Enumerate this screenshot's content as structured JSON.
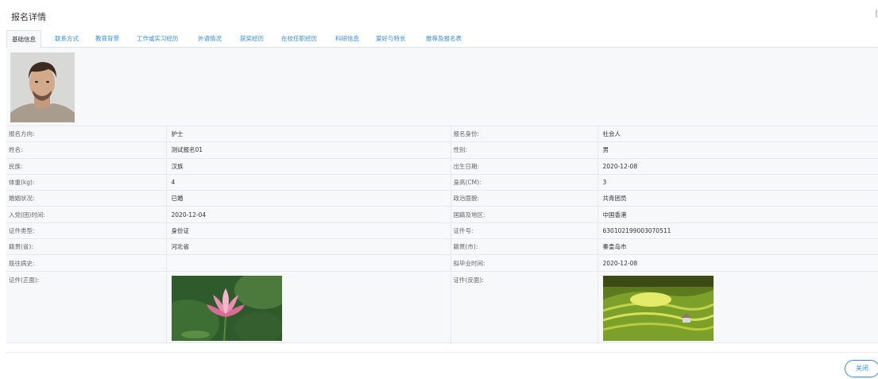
{
  "page": {
    "title": "报名详情"
  },
  "tabs": [
    {
      "label": "基础信息",
      "active": true
    },
    {
      "label": "联系方式"
    },
    {
      "label": "教育背景"
    },
    {
      "label": "工作或实习经历"
    },
    {
      "label": "外语情况"
    },
    {
      "label": "获奖经历"
    },
    {
      "label": "在校任职经历"
    },
    {
      "label": "科研信息"
    },
    {
      "label": "爱好与特长"
    },
    {
      "label": "推荐及报名表"
    }
  ],
  "fields": {
    "direction": {
      "label": "报名方向:",
      "value": "护士"
    },
    "identity": {
      "label": "报名身份:",
      "value": "社会人"
    },
    "name": {
      "label": "姓名:",
      "value": "测试报名01"
    },
    "gender": {
      "label": "性别:",
      "value": "男"
    },
    "ethnicity": {
      "label": "民族:",
      "value": "汉族"
    },
    "birth_date": {
      "label": "出生日期:",
      "value": "2020-12-08"
    },
    "weight": {
      "label": "体重(kg):",
      "value": "4"
    },
    "height": {
      "label": "身高(CM):",
      "value": "3"
    },
    "marital": {
      "label": "婚姻状况:",
      "value": "已婚"
    },
    "political": {
      "label": "政治面貌:",
      "value": "共青团员"
    },
    "party_date": {
      "label": "入党(团)时间:",
      "value": "2020-12-04"
    },
    "nationality": {
      "label": "国籍及地区:",
      "value": "中国香港"
    },
    "id_type": {
      "label": "证件类型:",
      "value": "身份证"
    },
    "id_number": {
      "label": "证件号:",
      "value": "630102199003070511"
    },
    "origin_province": {
      "label": "籍贯(省):",
      "value": "河北省"
    },
    "origin_city": {
      "label": "籍贯(市):",
      "value": "秦皇岛市"
    },
    "medical_history": {
      "label": "既往病史:",
      "value": ""
    },
    "graduation_date": {
      "label": "拟毕业时间:",
      "value": "2020-12-08"
    },
    "id_front": {
      "label": "证件(正面):"
    },
    "id_back": {
      "label": "证件(反面):"
    }
  },
  "footer": {
    "close_label": "关闭"
  }
}
